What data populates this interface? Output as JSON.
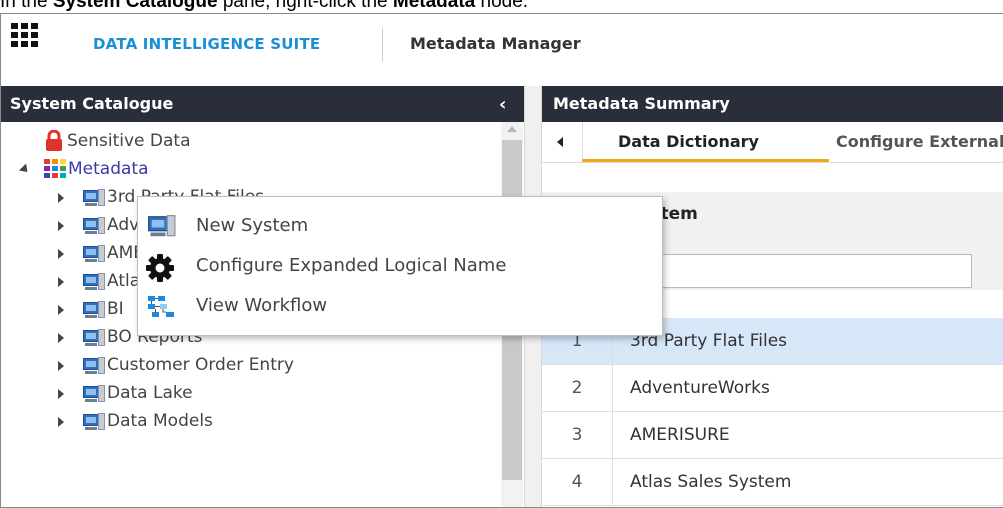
{
  "caption": {
    "prefix": "In the ",
    "pane": "System Catalogue",
    "middle": " pane, right-click the ",
    "node": "Metadata",
    "suffix": " node."
  },
  "header": {
    "brand": "DATA INTELLIGENCE SUITE",
    "module": "Metadata Manager"
  },
  "left_panel": {
    "title": "System Catalogue",
    "collapse_icon": "chevron-left-icon",
    "tree": [
      {
        "label": "Sensitive Data",
        "icon": "lock-icon"
      },
      {
        "label": "Metadata",
        "icon": "metadata-grid-icon"
      },
      {
        "label": "3rd Party Flat Files",
        "icon": "system-icon"
      },
      {
        "label": "AdventureWorks",
        "icon": "system-icon"
      },
      {
        "label": "AMERISURE",
        "icon": "system-icon"
      },
      {
        "label": "Atlas Sales System",
        "icon": "system-icon"
      },
      {
        "label": "BI",
        "icon": "system-icon"
      },
      {
        "label": "BO Reports",
        "icon": "system-icon"
      },
      {
        "label": "Customer Order Entry",
        "icon": "system-icon"
      },
      {
        "label": "Data Lake",
        "icon": "system-icon"
      },
      {
        "label": "Data Models",
        "icon": "system-icon"
      }
    ]
  },
  "context_menu": {
    "items": [
      {
        "label": "New System",
        "icon": "system-icon"
      },
      {
        "label": "Configure Expanded Logical Name",
        "icon": "gear-icon"
      },
      {
        "label": "View Workflow",
        "icon": "workflow-icon"
      }
    ]
  },
  "right_panel": {
    "title": "Metadata Summary",
    "tabs": [
      {
        "label": "Data Dictionary",
        "active": true
      },
      {
        "label": "Configure External",
        "active": false
      }
    ],
    "column_header": "System",
    "rows": [
      {
        "num": "1",
        "name": "3rd Party Flat Files",
        "selected": true
      },
      {
        "num": "2",
        "name": "AdventureWorks",
        "selected": false
      },
      {
        "num": "3",
        "name": "AMERISURE",
        "selected": false
      },
      {
        "num": "4",
        "name": "Atlas Sales System",
        "selected": false
      }
    ]
  },
  "colors": {
    "brand": "#1a8fd6",
    "header_bg": "#2a2e3a",
    "tab_underline": "#f3a51b",
    "selected_row": "#d6e7f8"
  }
}
